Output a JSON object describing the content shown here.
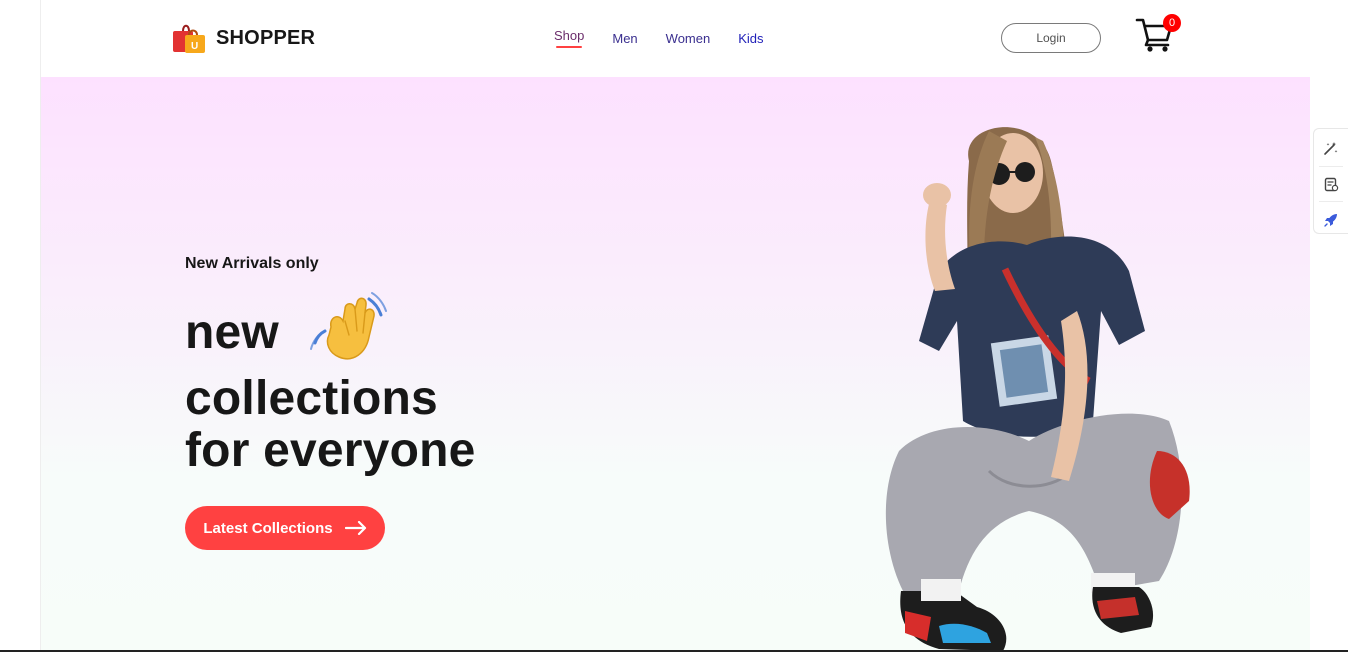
{
  "brand": {
    "name": "SHOPPER",
    "logo_icon": "shopping-bag-icon"
  },
  "nav": {
    "items": [
      {
        "label": "Shop",
        "active": true
      },
      {
        "label": "Men",
        "active": false
      },
      {
        "label": "Women",
        "active": false
      },
      {
        "label": "Kids",
        "active": false
      }
    ]
  },
  "header": {
    "login_label": "Login",
    "cart_count": "0",
    "cart_icon": "cart-icon"
  },
  "hero": {
    "tagline": "New Arrivals only",
    "line1": "new",
    "line2": "collections",
    "line3": "for everyone",
    "wave_icon": "waving-hand-icon",
    "cta_label": "Latest Collections",
    "cta_icon": "arrow-right-icon",
    "image": "model-photo"
  },
  "side_toolbar": {
    "icons": [
      "magic-wand-icon",
      "clipboard-settings-icon",
      "rocket-icon"
    ]
  },
  "colors": {
    "accent": "#ff4141",
    "hero_gradient_top": "#fde1ff",
    "hero_gradient_bottom": "#f7fdf9",
    "text_dark": "#171717"
  }
}
